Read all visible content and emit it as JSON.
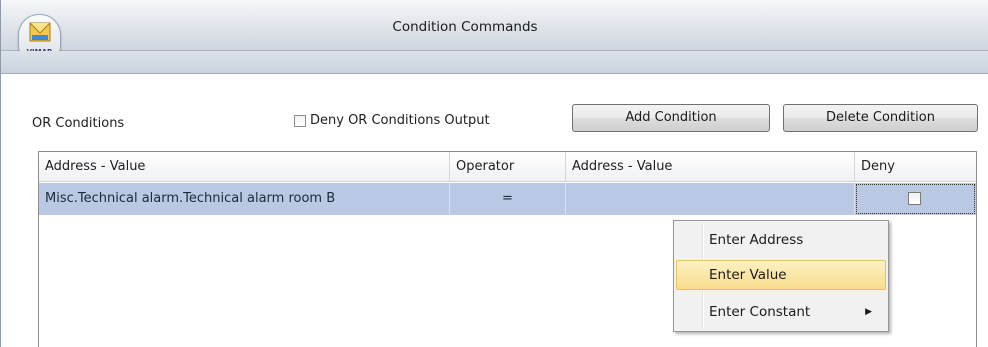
{
  "window": {
    "title": "Condition Commands",
    "logo_text": "VIMAR"
  },
  "toolbar": {
    "or_conditions_label": "OR Conditions",
    "deny_or_label": "Deny OR Conditions Output",
    "deny_or_checked": false,
    "add_condition_label": "Add Condition",
    "delete_condition_label": "Delete Condition"
  },
  "grid": {
    "columns": [
      "Address - Value",
      "Operator",
      "Address - Value",
      "Deny"
    ],
    "rows": [
      {
        "left": "Misc.Technical alarm.Technical alarm room B",
        "operator": "=",
        "right": "",
        "deny": false
      }
    ]
  },
  "context_menu": {
    "items": [
      "Enter Address",
      "Enter Value",
      "Enter Constant"
    ],
    "highlighted_index": 1,
    "submenu_arrow": "▶"
  },
  "colors": {
    "selection": "#b9c8e3",
    "menu_highlight": "#f8dc8a"
  }
}
